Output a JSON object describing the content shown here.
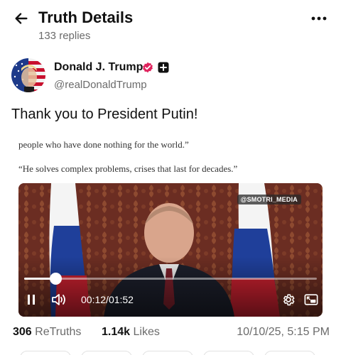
{
  "header": {
    "title": "Truth Details",
    "subtitle": "133 replies"
  },
  "author": {
    "name": "Donald J. Trump",
    "handle": "@realDonaldTrump",
    "verified_color": "#e0245e"
  },
  "post": {
    "text": "Thank you to President Putin!",
    "media": {
      "quote_line_1": "people who have done nothing for the world.”",
      "quote_line_2": "“He solves complex problems, crises that last for decades.”",
      "watermark": "@SMOTRI_MEDIA",
      "current_time": "00:12",
      "duration": "01:52",
      "progress_fraction": 0.107
    }
  },
  "stats": {
    "retruths_count": "306",
    "retruths_label": "ReTruths",
    "likes_count": "1.14k",
    "likes_label": "Likes",
    "timestamp": "10/10/25, 5:15 PM"
  },
  "icons": {
    "back": "arrow-left-icon",
    "more": "more-horizontal-icon",
    "pause": "pause-icon",
    "volume": "volume-icon",
    "settings": "gear-icon",
    "pip": "picture-in-picture-icon"
  }
}
